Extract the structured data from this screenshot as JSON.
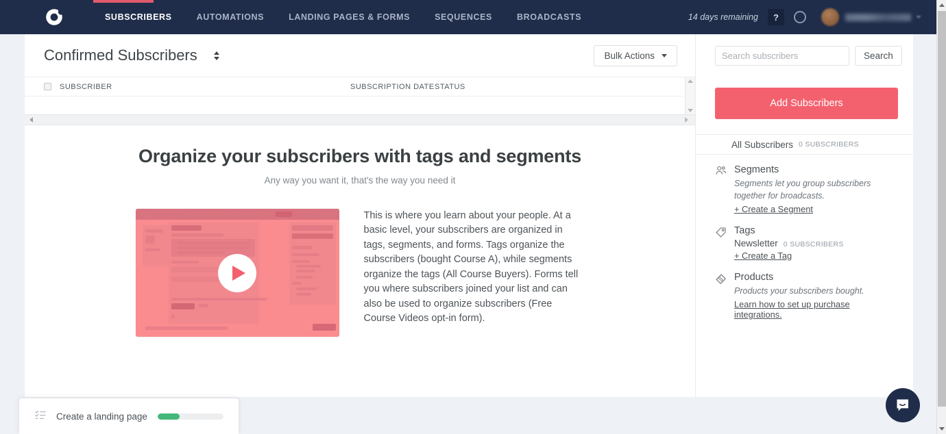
{
  "nav": {
    "logo_icon": "convertkit-logo-icon",
    "links": [
      {
        "label": "SUBSCRIBERS",
        "active": true
      },
      {
        "label": "AUTOMATIONS",
        "active": false
      },
      {
        "label": "LANDING PAGES & FORMS",
        "active": false
      },
      {
        "label": "SEQUENCES",
        "active": false
      },
      {
        "label": "BROADCASTS",
        "active": false
      }
    ],
    "trial_text": "14 days remaining",
    "help_label": "?",
    "notifications_icon": "ring-icon",
    "avatar_icon": "user-avatar",
    "accent_color": "#e05a6b",
    "bar_color": "#1f2d4a"
  },
  "page": {
    "title": "Confirmed Subscribers",
    "sort_icon": "sort-updown-icon",
    "bulk_actions_label": "Bulk Actions"
  },
  "table": {
    "columns": [
      "SUBSCRIBER",
      "SUBSCRIPTION DATE",
      "STATUS"
    ],
    "rows": []
  },
  "empty_state": {
    "title": "Organize your subscribers with tags and segments",
    "subtitle": "Any way you want it, that's the way you need it",
    "video_icon": "play-icon",
    "body": "This is where you learn about your people. At a basic level, your subscribers are organized in tags, segments, and forms. Tags organize the subscribers (bought Course A), while segments organize the tags (All Course Buyers). Forms tell you where subscribers joined your list and can also be used to organize subscribers (Free Course Videos opt-in form)."
  },
  "sidebar": {
    "search": {
      "placeholder": "Search subscribers",
      "value": "",
      "button_label": "Search"
    },
    "add_subscribers_label": "Add Subscribers",
    "add_subscribers_color": "#f4616e",
    "all_subscribers": {
      "label": "All Subscribers",
      "count": "0 SUBSCRIBERS"
    },
    "segments": {
      "icon": "people-icon",
      "title": "Segments",
      "description": "Segments let you group subscribers together for broadcasts.",
      "link": "+ Create a Segment"
    },
    "tags": {
      "icon": "tag-icon",
      "title": "Tags",
      "items": [
        {
          "name": "Newsletter",
          "count": "0 SUBSCRIBERS"
        }
      ],
      "link": "+ Create a Tag"
    },
    "products": {
      "icon": "price-tag-icon",
      "title": "Products",
      "description": "Products your subscribers bought.",
      "link": "Learn how to set up purchase integrations."
    }
  },
  "landing_widget": {
    "icon": "checklist-icon",
    "label": "Create a landing page",
    "progress_percent": 33,
    "progress_color": "#44b87a"
  },
  "intercom": {
    "icon": "chat-bubble-icon",
    "color": "#1f2d4a"
  }
}
